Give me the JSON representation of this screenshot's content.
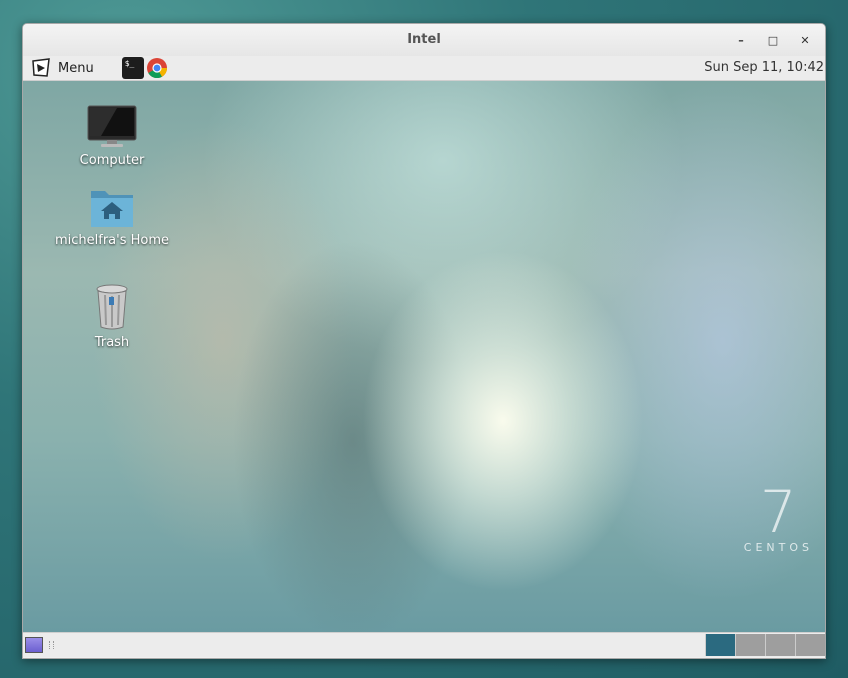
{
  "window": {
    "title": "Intel",
    "buttons": {
      "minimize": "–",
      "maximize": "□",
      "close": "✕"
    }
  },
  "top_panel": {
    "menu_label": "Menu",
    "launchers": [
      {
        "name": "terminal-icon",
        "text": "$_"
      },
      {
        "name": "chrome-icon",
        "text": ""
      }
    ],
    "clock": "Sun Sep 11, 10:42"
  },
  "desktop": {
    "icons": [
      {
        "label": "Computer",
        "icon": "computer-monitor-icon"
      },
      {
        "label": "michelfra's Home",
        "icon": "home-folder-icon"
      },
      {
        "label": "Trash",
        "icon": "trash-can-icon"
      }
    ],
    "watermark": {
      "number": "7",
      "word": "CENTOS"
    }
  },
  "bottom_panel": {
    "workspaces": [
      {
        "active": true
      },
      {
        "active": false
      },
      {
        "active": false
      },
      {
        "active": false
      }
    ]
  },
  "colors": {
    "active_workspace": "#2b6a80",
    "inactive_workspace": "#9e9e9e",
    "panel": "#ececec"
  }
}
